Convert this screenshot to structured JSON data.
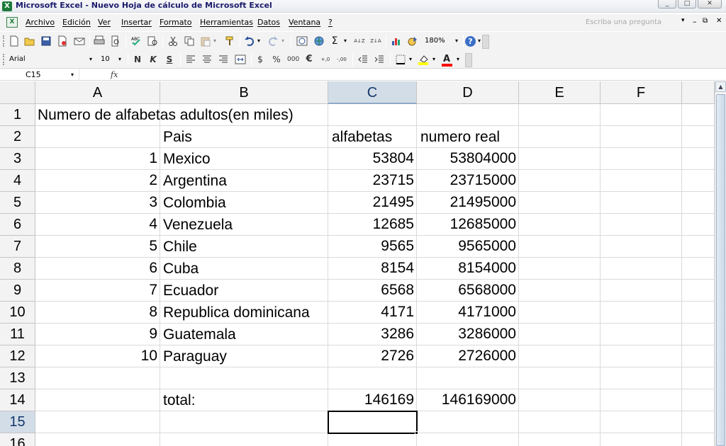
{
  "window": {
    "title": "Microsoft Excel - Nuevo Hoja de cálculo de Microsoft Excel",
    "app_icon_glyph": "X",
    "minimize_glyph": "_",
    "maximize_glyph": "□",
    "close_glyph": "✕"
  },
  "menu": {
    "doc_icon_glyph": "X",
    "items": [
      "Archivo",
      "Edición",
      "Ver",
      "Insertar",
      "Formato",
      "Herramientas",
      "Datos",
      "Ventana",
      "?"
    ],
    "ask_placeholder": "Escriba una pregunta",
    "ask_arrow": "▾",
    "doc_minimize": "–",
    "doc_restore": "⧉",
    "doc_close": "✕"
  },
  "standard_toolbar": {
    "icons": [
      "new-icon",
      "open-icon",
      "save-icon",
      "permission-icon",
      "email-icon",
      "print-icon",
      "print-preview-icon",
      "spelling-icon",
      "research-icon",
      "cut-icon",
      "copy-icon",
      "paste-icon",
      "format-painter-icon",
      "undo-icon",
      "redo-icon",
      "hyperlink-icon",
      "autosum-icon",
      "sort-ascending-icon",
      "sort-descending-icon",
      "chart-wizard-icon",
      "drawing-icon",
      "help-icon"
    ],
    "autosum_glyph": "Σ",
    "sort_asc_glyph": "A↓Z",
    "sort_desc_glyph": "Z↓A",
    "zoom": "180%",
    "help_glyph": "?"
  },
  "formatting_toolbar": {
    "font_name": "Arial",
    "font_size": "10",
    "bold": "N",
    "italic": "K",
    "underline": "S",
    "currency": "$",
    "percent": "%",
    "thousands": "000",
    "euro": "€",
    "increase_decimal": "+,0",
    "decrease_decimal": "-,00",
    "font_color_glyph": "A",
    "fill_color": "#ffff00",
    "font_color": "#ff0000"
  },
  "formula_bar": {
    "name_box": "C15",
    "fx": "fx",
    "formula": ""
  },
  "sheet": {
    "columns": [
      "A",
      "B",
      "C",
      "D",
      "E",
      "F"
    ],
    "selected_column": "C",
    "rows_visible": [
      "1",
      "2",
      "3",
      "4",
      "5",
      "6",
      "7",
      "8",
      "9",
      "10",
      "11",
      "12",
      "13",
      "14",
      "15",
      "16"
    ],
    "selected_row": "15",
    "active_cell": "C15",
    "title": "Numero de alfabetas adultos(en miles)",
    "headers": {
      "b": "Pais",
      "c": "alfabetas",
      "d": "numero real"
    },
    "data": [
      {
        "n": "1",
        "pais": "Mexico",
        "alfabetas": "53804",
        "real": "53804000"
      },
      {
        "n": "2",
        "pais": "Argentina",
        "alfabetas": "23715",
        "real": "23715000"
      },
      {
        "n": "3",
        "pais": "Colombia",
        "alfabetas": "21495",
        "real": "21495000"
      },
      {
        "n": "4",
        "pais": "Venezuela",
        "alfabetas": "12685",
        "real": "12685000"
      },
      {
        "n": "5",
        "pais": "Chile",
        "alfabetas": "9565",
        "real": "9565000"
      },
      {
        "n": "6",
        "pais": "Cuba",
        "alfabetas": "8154",
        "real": "8154000"
      },
      {
        "n": "7",
        "pais": "Ecuador",
        "alfabetas": "6568",
        "real": "6568000"
      },
      {
        "n": "8",
        "pais": "Republica dominicana",
        "alfabetas": "4171",
        "real": "4171000"
      },
      {
        "n": "9",
        "pais": "Guatemala",
        "alfabetas": "3286",
        "real": "3286000"
      },
      {
        "n": "10",
        "pais": "Paraguay",
        "alfabetas": "2726",
        "real": "2726000"
      }
    ],
    "total": {
      "label": "total:",
      "alfabetas": "146169",
      "real": "146169000"
    }
  },
  "scrollbar": {
    "up_glyph": "▲"
  }
}
